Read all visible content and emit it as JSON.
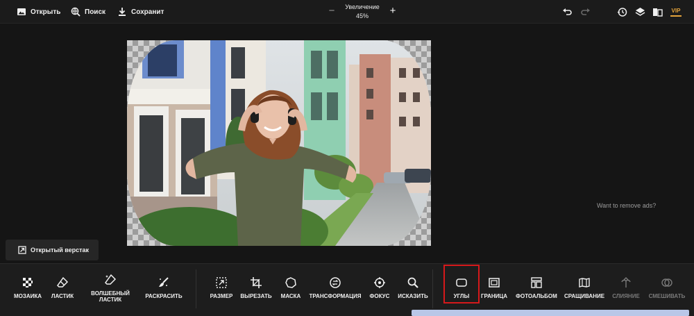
{
  "topbar": {
    "open_label": "Открыть",
    "search_label": "Поиск",
    "save_label": "Сохранит",
    "zoom_label": "Увеличение",
    "zoom_value": "45%",
    "zoom_minus": "−",
    "zoom_plus": "+",
    "vip_label": "VIP"
  },
  "main": {
    "ads_text": "Want to remove ads?",
    "open_layout_label": "Открытый верстак"
  },
  "tools_left": [
    {
      "label": "МОЗАИКА",
      "icon": "mosaic-icon"
    },
    {
      "label": "ЛАСТИК",
      "icon": "eraser-icon"
    },
    {
      "label": "ВОЛШЕБНЫЙ ЛАСТИК",
      "icon": "magic-eraser-icon"
    },
    {
      "label": "РАСКРАСИТЬ",
      "icon": "paint-icon"
    }
  ],
  "tools_mid": [
    {
      "label": "РАЗМЕР",
      "icon": "resize-icon"
    },
    {
      "label": "ВЫРЕЗАТЬ",
      "icon": "crop-icon"
    },
    {
      "label": "МАСКА",
      "icon": "mask-icon"
    },
    {
      "label": "ТРАНСФОРМАЦИЯ",
      "icon": "transform-icon"
    },
    {
      "label": "ФОКУС",
      "icon": "focus-icon"
    },
    {
      "label": "ИСКАЗИТЬ",
      "icon": "distort-icon"
    }
  ],
  "tools_right": [
    {
      "label": "УГЛЫ",
      "icon": "corners-icon",
      "selected": true
    },
    {
      "label": "ГРАНИЦА",
      "icon": "border-icon"
    },
    {
      "label": "ФОТОАЛЬБОМ",
      "icon": "photo-album-icon"
    },
    {
      "label": "СРАЩИВАНИЕ",
      "icon": "splice-icon"
    },
    {
      "label": "СЛИЯНИЕ",
      "icon": "merge-icon",
      "disabled": true
    },
    {
      "label": "СМЕШИВАТЬ",
      "icon": "blend-icon",
      "disabled": true
    }
  ],
  "colors": {
    "background": "#151515",
    "toolbar": "#1d1d1d",
    "selection": "#d6191b",
    "vip": "#e5a43b",
    "scrollbar": "#b9c7e8"
  }
}
